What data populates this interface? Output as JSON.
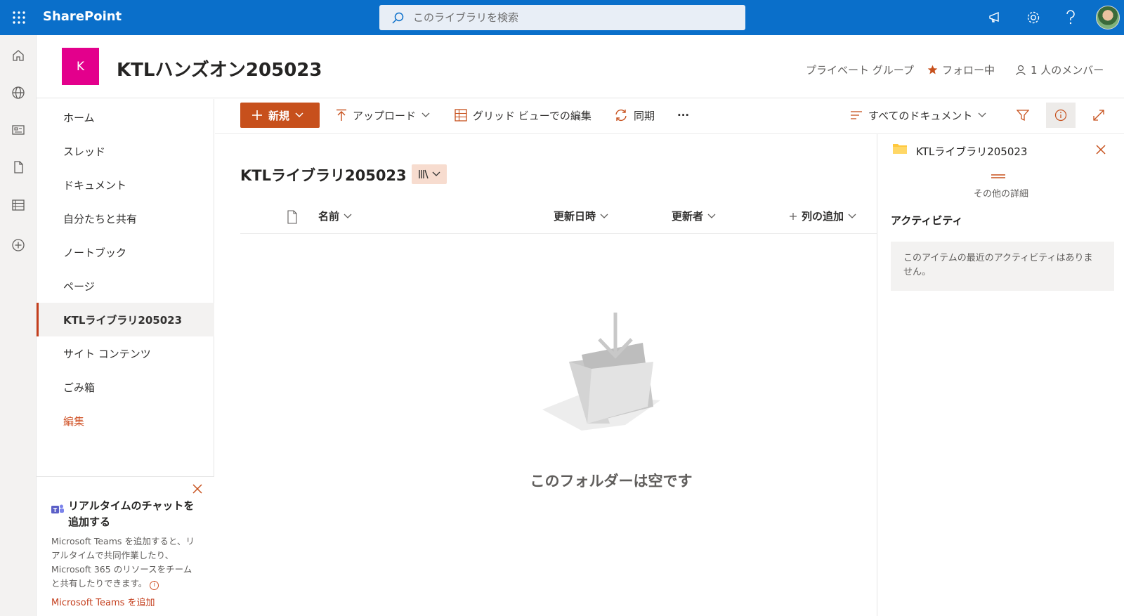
{
  "suitebar": {
    "brand": "SharePoint",
    "search_placeholder": "このライブラリを検索"
  },
  "site": {
    "logo_letter": "K",
    "title": "KTLハンズオン205023",
    "privacy": "プライベート グループ",
    "follow": "フォロー中",
    "members": "1 人のメンバー"
  },
  "nav": {
    "items": [
      {
        "label": "ホーム"
      },
      {
        "label": "スレッド"
      },
      {
        "label": "ドキュメント"
      },
      {
        "label": "自分たちと共有"
      },
      {
        "label": "ノートブック"
      },
      {
        "label": "ページ"
      },
      {
        "label": "KTLライブラリ205023"
      },
      {
        "label": "サイト コンテンツ"
      },
      {
        "label": "ごみ箱"
      },
      {
        "label": "編集"
      }
    ],
    "selected_index": 6
  },
  "teams_card": {
    "title": "リアルタイムのチャットを追加する",
    "body": "Microsoft Teams を追加すると、リアルタイムで共同作業したり、Microsoft 365 のリソースをチームと共有したりできます。",
    "link": "Microsoft Teams を追加"
  },
  "commandbar": {
    "new": "新規",
    "upload": "アップロード",
    "grid_edit": "グリッド ビューでの編集",
    "sync": "同期",
    "more": "···",
    "view": "すべてのドキュメント"
  },
  "library": {
    "title": "KTLライブラリ205023",
    "columns": {
      "name": "名前",
      "modified": "更新日時",
      "modified_by": "更新者",
      "add_column": "列の追加"
    },
    "empty_message": "このフォルダーは空です"
  },
  "details_pane": {
    "title": "KTLライブラリ205023",
    "more_details": "その他の詳細",
    "activity_title": "アクティビティ",
    "activity_empty": "このアイテムの最近のアクティビティはありません。"
  },
  "colors": {
    "suitebar": "#0a6fca",
    "accent": "#c7501c",
    "site_logo": "#e3008c"
  }
}
